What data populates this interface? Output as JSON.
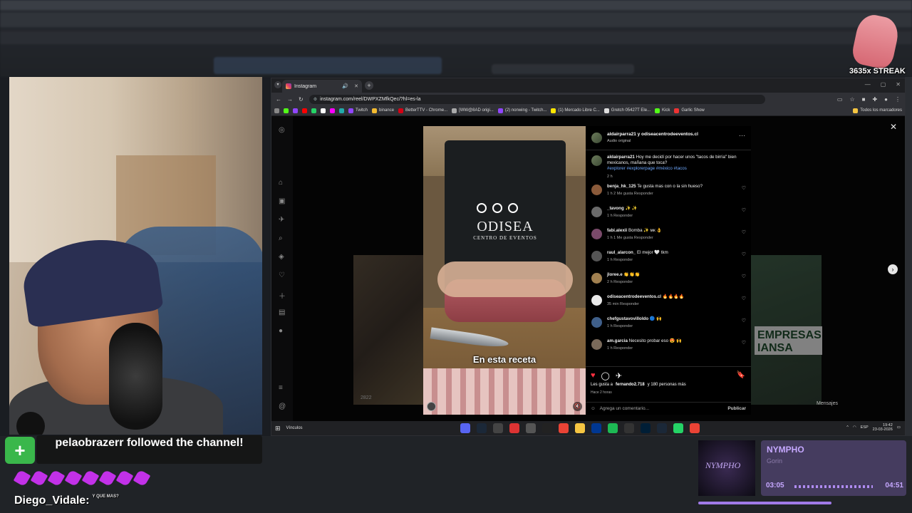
{
  "stream": {
    "streak": "3635x STREAK",
    "follow_icon": "add-user-icon",
    "follow_text": "pelaobrazerr followed the channel!",
    "chat_partial": "...........",
    "chat_user": "Diego_Vidale:",
    "chat_small": "Y QUE MAS?"
  },
  "browser": {
    "tab_title": "Instagram",
    "url": "instagram.com/reel/DWPXZMfkQec/?hl=es-la",
    "bookmarks": [
      "Twitch",
      "binance",
      "BetterTTV - Chrome...",
      "[WW@8AD origi...",
      "(2) nonwing - Twitch...",
      "(1) Mercado Libre C...",
      "Gretch 05427T Ele...",
      "Kick",
      "Garlic Show"
    ],
    "all_bookmarks": "Todos los marcadores"
  },
  "post": {
    "author_line": "aldairparra21 y odiseacentrodeeventos.cl",
    "audio": "Audio original",
    "caption_user": "aldairparra21",
    "caption": "Hoy me decidí por hacer unos \"tacos de birria\" bien mexicanos, mañana que toca?",
    "hashtags": "#explorer #explorerpage #méxico #tacos",
    "caption_age": "2 h",
    "video_caption": "En esta receta",
    "side_count": "2822",
    "side_brand": "EMPRESAS IANSA",
    "likes_prefix": "Les gusta a",
    "likes_user": "fernando2.718",
    "likes_suffix": "y 180 personas más",
    "posted": "Hace 2 horas",
    "add_comment": "Agrega un comentario...",
    "publish": "Publicar",
    "messages": "Mensajes"
  },
  "comments": [
    {
      "user": "benja_hk_125",
      "text": "Te gusta mas con o la sin hueso?",
      "meta": "1 h   2 Me gusta   Responder"
    },
    {
      "user": "_tavong",
      "text": "✨ ✨",
      "meta": "1 h   Responder"
    },
    {
      "user": "fabi.alexii",
      "text": "Bomba ✨ мк 👌",
      "meta": "1 h   1 Me gusta   Responder"
    },
    {
      "user": "raul_alarcon_",
      "text": "El mejor 🤍 tkm",
      "meta": "1 h   Responder"
    },
    {
      "user": "jloree.e",
      "text": "👏👏👏",
      "meta": "2 h   Responder"
    },
    {
      "user": "odiseacentrodeeventos.cl",
      "text": "🔥🔥🔥🔥",
      "meta": "35 min   Responder"
    },
    {
      "user": "chefgustavovilloldo",
      "text": "🔵 🙌",
      "meta": "1 h   Responder"
    },
    {
      "user": "am.garcia",
      "text": "Necesito probar eso 😍 🙌",
      "meta": "1 h   Responder"
    }
  ],
  "taskbar": {
    "weather": "Vínculos",
    "lang": "ESP",
    "time": "19:42",
    "date": "23-03-2026"
  },
  "now_playing": {
    "title": "NYMPHO",
    "artist": "Gorin",
    "elapsed": "03:05",
    "total": "04:51",
    "progress": 0.64
  }
}
